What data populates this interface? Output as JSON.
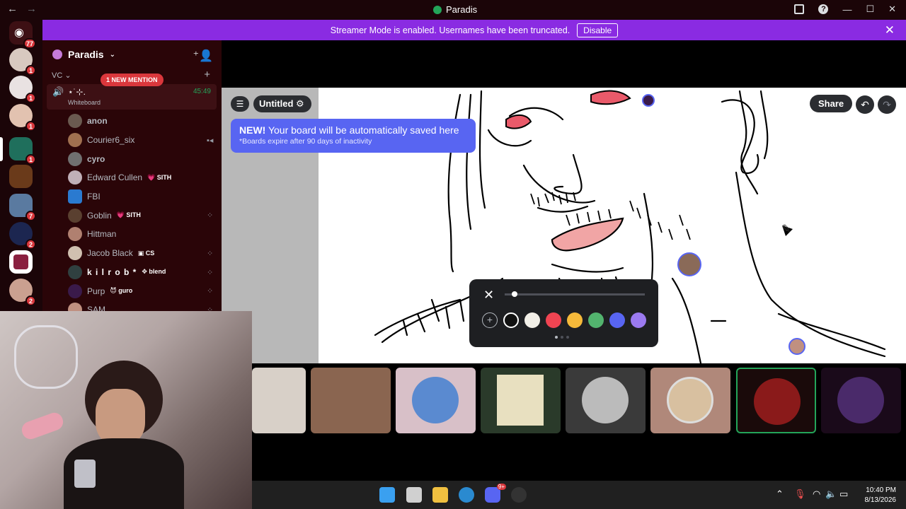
{
  "window": {
    "title": "Paradis"
  },
  "banner": {
    "text": "Streamer Mode is enabled. Usernames have been truncated.",
    "button": "Disable"
  },
  "rail": {
    "home_badge": "77",
    "servers": [
      {
        "badge": "1"
      },
      {
        "badge": "1"
      },
      {
        "badge": "1"
      },
      {
        "badge": "1"
      },
      {
        "badge": ""
      },
      {
        "badge": "7"
      },
      {
        "badge": "2"
      },
      {
        "badge": ""
      },
      {
        "badge": "2"
      }
    ]
  },
  "sidebar": {
    "guild_name": "Paradis",
    "category": "VC",
    "mention_pill": "1 NEW MENTION",
    "voice_channel": {
      "name": "⋆˙⊹.",
      "timer": "45:49",
      "activity": "Whiteboard"
    },
    "members": [
      {
        "name": "anon",
        "tag": ""
      },
      {
        "name": "Courier6_six",
        "tag": ""
      },
      {
        "name": "cyro",
        "tag": ""
      },
      {
        "name": "Edward Cullen",
        "tag": "SITH"
      },
      {
        "name": "FBI",
        "tag": ""
      },
      {
        "name": "Goblin",
        "tag": "SITH"
      },
      {
        "name": "Hittman",
        "tag": ""
      },
      {
        "name": "Jacob Black",
        "tag": "CS"
      },
      {
        "name": "k i l r o b *",
        "tag": "blend"
      },
      {
        "name": "Purp",
        "tag": "guro"
      },
      {
        "name": "SAM",
        "tag": ""
      }
    ]
  },
  "whiteboard": {
    "board_title": "Untitled",
    "tip_bold": "NEW!",
    "tip_text": "Your board will be automatically saved here",
    "tip_sub": "*Boards expire after 90 days of inactivity",
    "share_label": "Share",
    "colors": [
      "#ffffff00",
      "#111111",
      "#f2efe8",
      "#f04452",
      "#f5b93a",
      "#52b36e",
      "#5865f2",
      "#9b7af0"
    ]
  },
  "taskbar": {
    "time": "10:40 PM",
    "date": "8/13/2026",
    "discord_badge": "9+"
  }
}
